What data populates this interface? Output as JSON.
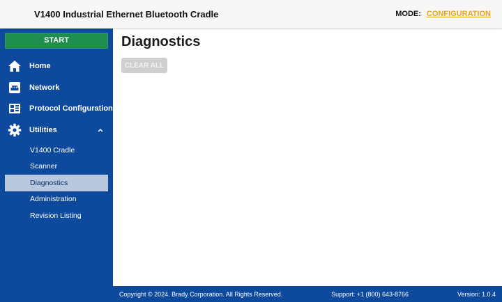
{
  "header": {
    "title": "V1400 Industrial Ethernet Bluetooth Cradle",
    "mode_label": "MODE:",
    "mode_value": "CONFIGURATION"
  },
  "sidebar": {
    "start_label": "START",
    "items": [
      {
        "label": "Home",
        "icon": "home-icon"
      },
      {
        "label": "Network",
        "icon": "network-port-icon"
      },
      {
        "label": "Protocol Configuration",
        "icon": "protocol-config-icon"
      },
      {
        "label": "Utilities",
        "icon": "gear-icon",
        "expanded": true
      }
    ],
    "sub_items": [
      {
        "label": "V1400 Cradle"
      },
      {
        "label": "Scanner"
      },
      {
        "label": "Diagnostics",
        "active": true
      },
      {
        "label": "Administration"
      },
      {
        "label": "Revision Listing"
      }
    ]
  },
  "main": {
    "title": "Diagnostics",
    "clear_label": "CLEAR ALL"
  },
  "footer": {
    "copyright": "Copyright © 2024. Brady Corporation. All Rights Reserved.",
    "support": "Support: +1 (800) 643-8766",
    "version": "Version: 1.0.4"
  },
  "colors": {
    "sidebar_bg": "#0d4a9e",
    "start_green": "#1e8e4e",
    "mode_accent": "#e8a51c",
    "active_item_bg": "#b8c8df"
  }
}
